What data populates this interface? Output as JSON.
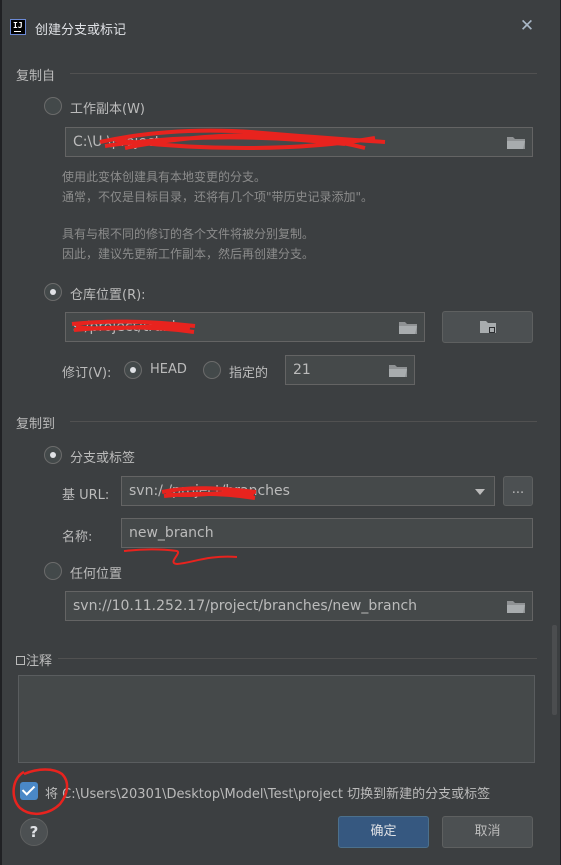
{
  "window": {
    "title": "创建分支或标记",
    "app_icon_text": "IJ"
  },
  "copy_from": {
    "header": "复制自",
    "working_copy": {
      "label": "工作副本(W)",
      "path": "C:\\U                                    \\project",
      "hint1": "使用此变体创建具有本地变更的分支。",
      "hint2": "通常，不仅是目标目录，还将有几个项\"带历史记录添加\"。",
      "hint3": "具有与根不同的修订的各个文件将被分别复制。",
      "hint4": "因此，建议先更新工作副本，然后再创建分支。",
      "selected": false
    },
    "repository": {
      "label": "仓库位置(R):",
      "path": "s                              /project/trunk",
      "selected": true
    },
    "revision": {
      "label": "修订(V):",
      "head_label": "HEAD",
      "head_selected": true,
      "specified_label": "指定的",
      "specified_selected": false,
      "value": "21"
    }
  },
  "copy_to": {
    "header": "复制到",
    "branch_or_tag": {
      "label": "分支或标签",
      "selected": true,
      "base_url_label": "基 URL:",
      "base_url_value": "svn:/                         /project/branches",
      "more_button": "...",
      "name_label": "名称:",
      "name_value": "new_branch"
    },
    "any_location": {
      "label": "任何位置",
      "selected": false,
      "path": "svn://10.11.252.17/project/branches/new_branch"
    }
  },
  "comment": {
    "header": "注释"
  },
  "switch_option": {
    "checked": true,
    "label": "将 C:\\Users\\20301\\Desktop\\Model\\Test\\project 切换到新建的分支或标签"
  },
  "buttons": {
    "ok": "确定",
    "cancel": "取消",
    "help": "?"
  },
  "colors": {
    "background": "#3c3f41",
    "field": "#45494a",
    "primary": "#365880",
    "checkbox": "#4a88c7",
    "annotation_red": "#e8231e"
  },
  "icons": {
    "folder": "folder-icon",
    "browse": "browse-repository-icon",
    "dropdown": "chevron-down-icon",
    "close": "close-icon"
  }
}
